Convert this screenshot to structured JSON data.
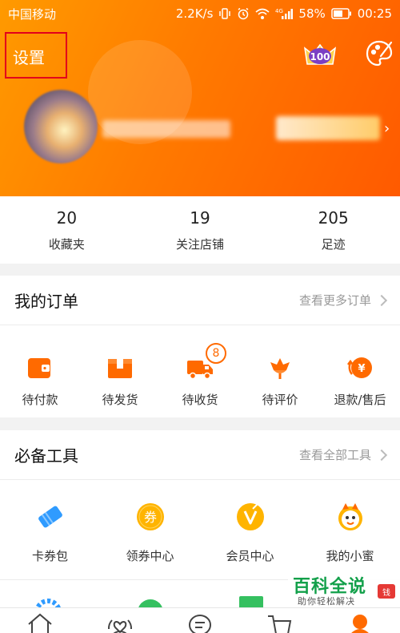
{
  "status_bar": {
    "carrier": "中国移动",
    "speed": "2.2K/s",
    "network": "4G",
    "battery": "58%",
    "time": "00:25"
  },
  "header": {
    "settings_label": "设置",
    "vip_level": "100",
    "colors": {
      "gradient_start": "#ff9a00",
      "gradient_end": "#ff5a00",
      "highlight_box": "#e3001b"
    }
  },
  "stats": [
    {
      "value": "20",
      "label": "收藏夹"
    },
    {
      "value": "19",
      "label": "关注店铺"
    },
    {
      "value": "205",
      "label": "足迹"
    }
  ],
  "orders": {
    "title": "我的订单",
    "more_link": "查看更多订单",
    "items": [
      {
        "label": "待付款",
        "icon": "wallet-icon"
      },
      {
        "label": "待发货",
        "icon": "package-icon"
      },
      {
        "label": "待收货",
        "icon": "truck-icon",
        "badge": "8"
      },
      {
        "label": "待评价",
        "icon": "flower-icon"
      },
      {
        "label": "退款/售后",
        "icon": "refund-icon"
      }
    ]
  },
  "tools": {
    "title": "必备工具",
    "more_link": "查看全部工具",
    "items": [
      {
        "label": "卡券包",
        "icon": "ticket-icon"
      },
      {
        "label": "领券中心",
        "icon": "coupon-icon",
        "glyph": "券"
      },
      {
        "label": "会员中心",
        "icon": "vip-icon"
      },
      {
        "label": "我的小蜜",
        "icon": "assistant-icon"
      }
    ]
  },
  "bottom_nav": {
    "items": [
      "home-icon",
      "heart-icon",
      "message-icon",
      "cart-icon",
      "profile-icon"
    ]
  },
  "watermark": {
    "title": "百科全说",
    "subtitle": "助你轻松解决",
    "badge": "钱"
  },
  "accent_color": "#ff6a00"
}
